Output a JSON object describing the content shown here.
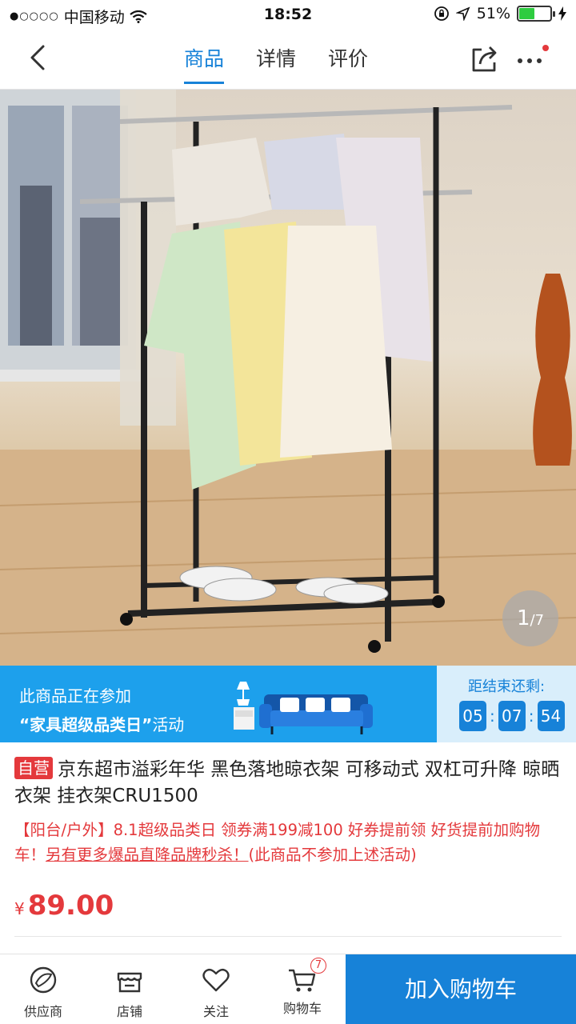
{
  "status_bar": {
    "carrier": "中国移动",
    "time": "18:52",
    "battery": "51%",
    "battery_level": 0.51
  },
  "nav": {
    "tabs": [
      "商品",
      "详情",
      "评价"
    ],
    "active_tab": 0
  },
  "gallery": {
    "current": "1",
    "total": "/7"
  },
  "promo": {
    "line1": "此商品正在参加",
    "quote_open": "“",
    "event_name": "家具超级品类日",
    "quote_close": "”",
    "suffix": "活动",
    "ends_label": "距结束还剩:",
    "hours": "05",
    "minutes": "07",
    "seconds": "54",
    "separator": ":"
  },
  "product": {
    "tag": "自营",
    "title": "京东超市溢彩年华 黑色落地晾衣架 可移动式 双杠可升降 晾晒衣架 挂衣架CRU1500",
    "desc_plain": "【阳台/户外】8.1超级品类日 领券满199减100 好券提前领 好货提前加购物车！",
    "desc_link": "另有更多爆品直降品牌秒杀！",
    "desc_note": "(此商品不参加上述活动)",
    "currency": "¥",
    "price": "89.00"
  },
  "bottom_bar": {
    "supplier": "供应商",
    "store": "店铺",
    "follow": "关注",
    "cart": "购物车",
    "cart_count": "7",
    "add_to_cart": "加入购物车"
  },
  "colors": {
    "accent": "#1782d8",
    "price_red": "#e4393c",
    "promo_blue": "#1da0ec"
  }
}
